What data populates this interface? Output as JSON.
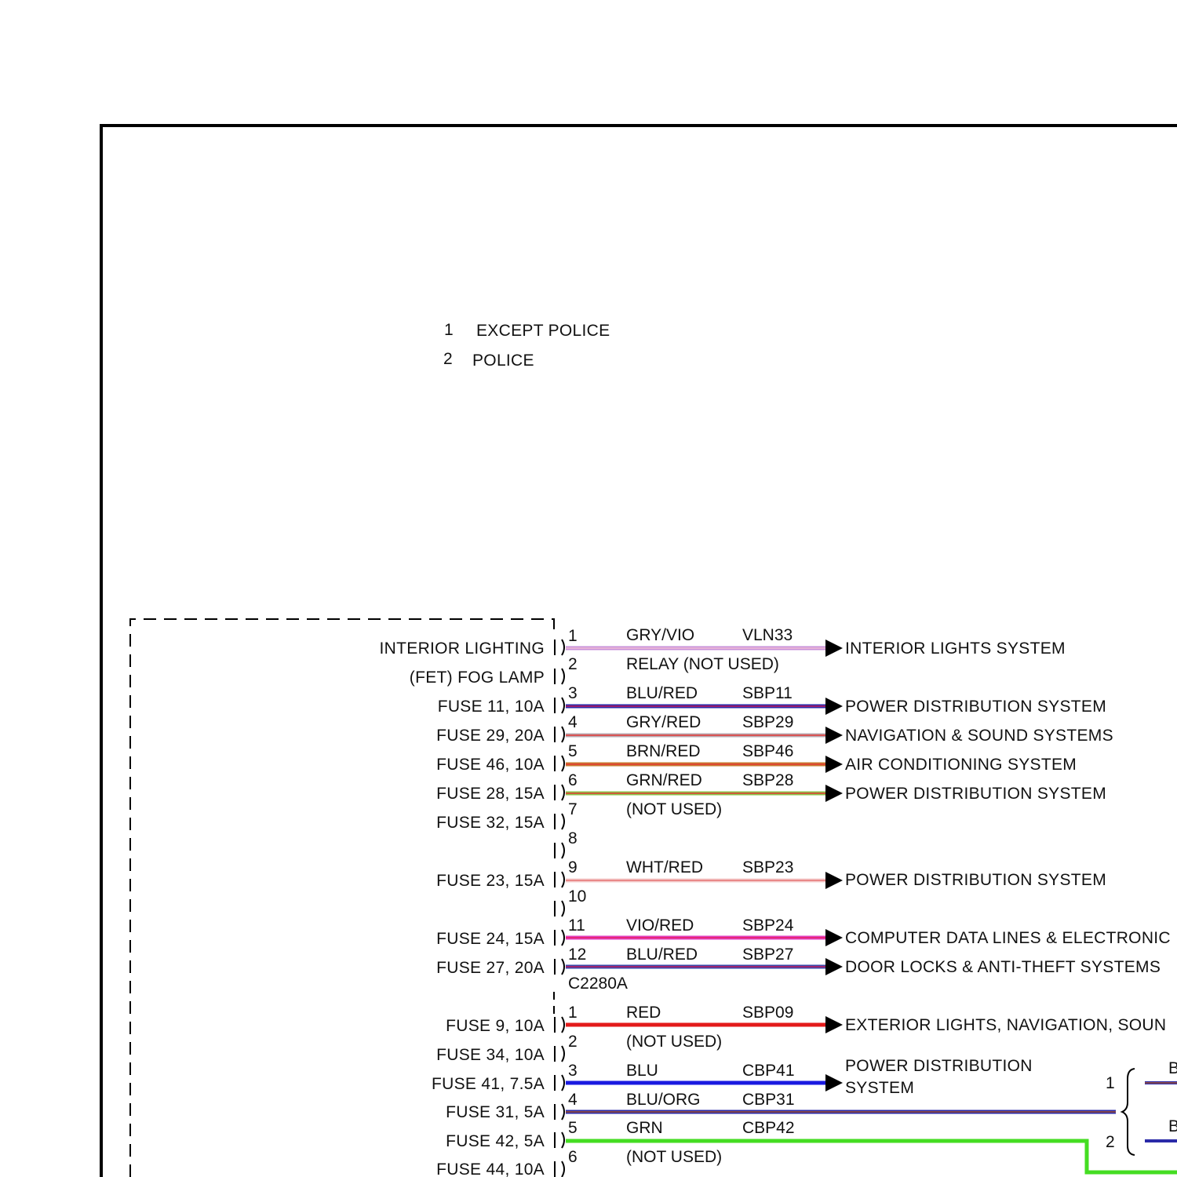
{
  "legend": [
    {
      "num": "1",
      "text": "EXCEPT POLICE"
    },
    {
      "num": "2",
      "text": "POLICE"
    }
  ],
  "connector_a": {
    "name": "C2280A",
    "pins": [
      {
        "pin": "1",
        "left_label": "INTERIOR LIGHTING",
        "color": "GRY/VIO",
        "circuit": "VLN33",
        "dest": "INTERIOR LIGHTS SYSTEM",
        "wire": [
          "#c78fd8",
          "#f2c0d8"
        ]
      },
      {
        "pin": "2",
        "left_label": "(FET) FOG LAMP",
        "note": "RELAY (NOT USED)"
      },
      {
        "pin": "3",
        "left_label": "FUSE 11, 10A",
        "color": "BLU/RED",
        "circuit": "SBP11",
        "dest": "POWER DISTRIBUTION SYSTEM",
        "wire": [
          "#2a2aa8",
          "#c2185b"
        ]
      },
      {
        "pin": "4",
        "left_label": "FUSE 29, 20A",
        "color": "GRY/RED",
        "circuit": "SBP29",
        "dest": "NAVIGATION & SOUND SYSTEMS",
        "wire": [
          "#b8a8b0",
          "#e53935"
        ]
      },
      {
        "pin": "5",
        "left_label": "FUSE 46, 10A",
        "color": "BRN/RED",
        "circuit": "SBP46",
        "dest": "AIR CONDITIONING SYSTEM",
        "wire": [
          "#c77a2e",
          "#e53935"
        ]
      },
      {
        "pin": "6",
        "left_label": "FUSE 28, 15A",
        "color": "GRN/RED",
        "circuit": "SBP28",
        "dest": "POWER DISTRIBUTION SYSTEM",
        "wire": [
          "#8bc34a",
          "#e53935"
        ]
      },
      {
        "pin": "7",
        "left_label": "FUSE 32, 15A",
        "note": "(NOT USED)"
      },
      {
        "pin": "8",
        "left_label": ""
      },
      {
        "pin": "9",
        "left_label": "FUSE 23, 15A",
        "color": "WHT/RED",
        "circuit": "SBP23",
        "dest": "POWER DISTRIBUTION SYSTEM",
        "wire": [
          "#f4cccc",
          "#e57373"
        ]
      },
      {
        "pin": "10",
        "left_label": ""
      },
      {
        "pin": "11",
        "left_label": "FUSE 24, 15A",
        "color": "VIO/RED",
        "circuit": "SBP24",
        "dest": "COMPUTER DATA LINES & ELECTRONIC",
        "wire": [
          "#e040c0",
          "#e91e63"
        ]
      },
      {
        "pin": "12",
        "left_label": "FUSE 27, 20A",
        "color": "BLU/RED",
        "circuit": "SBP27",
        "dest": "DOOR LOCKS & ANTI-THEFT SYSTEMS",
        "wire": [
          "#3949ab",
          "#c2185b"
        ]
      }
    ]
  },
  "connector_b": {
    "pins": [
      {
        "pin": "1",
        "left_label": "FUSE 9, 10A",
        "color": "RED",
        "circuit": "SBP09",
        "dest": "EXTERIOR LIGHTS, NAVIGATION, SOUN",
        "wire": [
          "#e31b1b",
          "#e31b1b"
        ]
      },
      {
        "pin": "2",
        "left_label": "FUSE 34, 10A",
        "note": "(NOT USED)"
      },
      {
        "pin": "3",
        "left_label": "FUSE 41, 7.5A",
        "color": "BLU",
        "circuit": "CBP41",
        "dest_lines": [
          "POWER DISTRIBUTION",
          "SYSTEM"
        ],
        "wire": [
          "#1a1ae0",
          "#1a1ae0"
        ]
      },
      {
        "pin": "4",
        "left_label": "FUSE 31, 5A",
        "color": "BLU/ORG",
        "circuit": "CBP31",
        "wire": [
          "#2a2aa8",
          "#a05030"
        ]
      },
      {
        "pin": "5",
        "left_label": "FUSE 42, 5A",
        "color": "GRN",
        "circuit": "CBP42",
        "wire": [
          "#44dd22",
          "#44dd22"
        ]
      },
      {
        "pin": "6",
        "left_label": "FUSE 44, 10A",
        "note": "(NOT USED)"
      }
    ]
  },
  "option_bracket": {
    "rows": [
      {
        "num": "1",
        "cut_label": "B"
      },
      {
        "num": "2",
        "cut_label": "B"
      }
    ]
  }
}
